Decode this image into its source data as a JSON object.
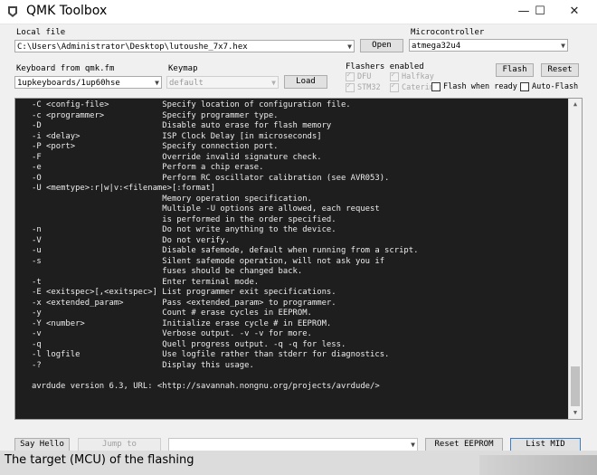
{
  "window": {
    "title": "QMK Toolbox",
    "controls": {
      "minimize": "—",
      "maximize": "☐",
      "close": "✕"
    }
  },
  "local_file": {
    "label": "Local file",
    "value": "C:\\Users\\Administrator\\Desktop\\lutoushe_7x7.hex",
    "open_label": "Open"
  },
  "microcontroller": {
    "label": "Microcontroller",
    "value": "atmega32u4"
  },
  "keyboard": {
    "label": "Keyboard from qmk.fm",
    "value": "1upkeyboards/1up60hse"
  },
  "keymap": {
    "label": "Keymap",
    "value": "default",
    "load_label": "Load"
  },
  "flashers": {
    "label": "Flashers enabled",
    "items": [
      "DFU",
      "Halfkay",
      "STM32",
      "Caterin"
    ]
  },
  "buttons": {
    "flash": "Flash",
    "reset": "Reset",
    "say_hello": "Say Hello",
    "jump_to": "Jump to",
    "reset_eeprom": "Reset EEPROM",
    "list_mid": "List MID"
  },
  "options": {
    "flash_when_ready": "Flash when ready",
    "auto_flash": "Auto-Flash"
  },
  "console_lines": [
    "-C <config-file>           Specify location of configuration file.",
    "-c <programmer>            Specify programmer type.",
    "-D                         Disable auto erase for flash memory",
    "-i <delay>                 ISP Clock Delay [in microseconds]",
    "-P <port>                  Specify connection port.",
    "-F                         Override invalid signature check.",
    "-e                         Perform a chip erase.",
    "-O                         Perform RC oscillator calibration (see AVR053).",
    "-U <memtype>:r|w|v:<filename>[:format]",
    "                           Memory operation specification.",
    "                           Multiple -U options are allowed, each request",
    "                           is performed in the order specified.",
    "-n                         Do not write anything to the device.",
    "-V                         Do not verify.",
    "-u                         Disable safemode, default when running from a script.",
    "-s                         Silent safemode operation, will not ask you if",
    "                           fuses should be changed back.",
    "-t                         Enter terminal mode.",
    "-E <exitspec>[,<exitspec>] List programmer exit specifications.",
    "-x <extended_param>        Pass <extended_param> to programmer.",
    "-y                         Count # erase cycles in EEPROM.",
    "-Y <number>                Initialize erase cycle # in EEPROM.",
    "-v                         Verbose output. -v -v for more.",
    "-q                         Quell progress output. -q -q for less.",
    "-l logfile                 Use logfile rather than stderr for diagnostics.",
    "-?                         Display this usage.",
    "",
    "avrdude version 6.3, URL: <http://savannah.nongnu.org/projects/avrdude/>"
  ],
  "status_caption": "The target (MCU) of the flashing"
}
